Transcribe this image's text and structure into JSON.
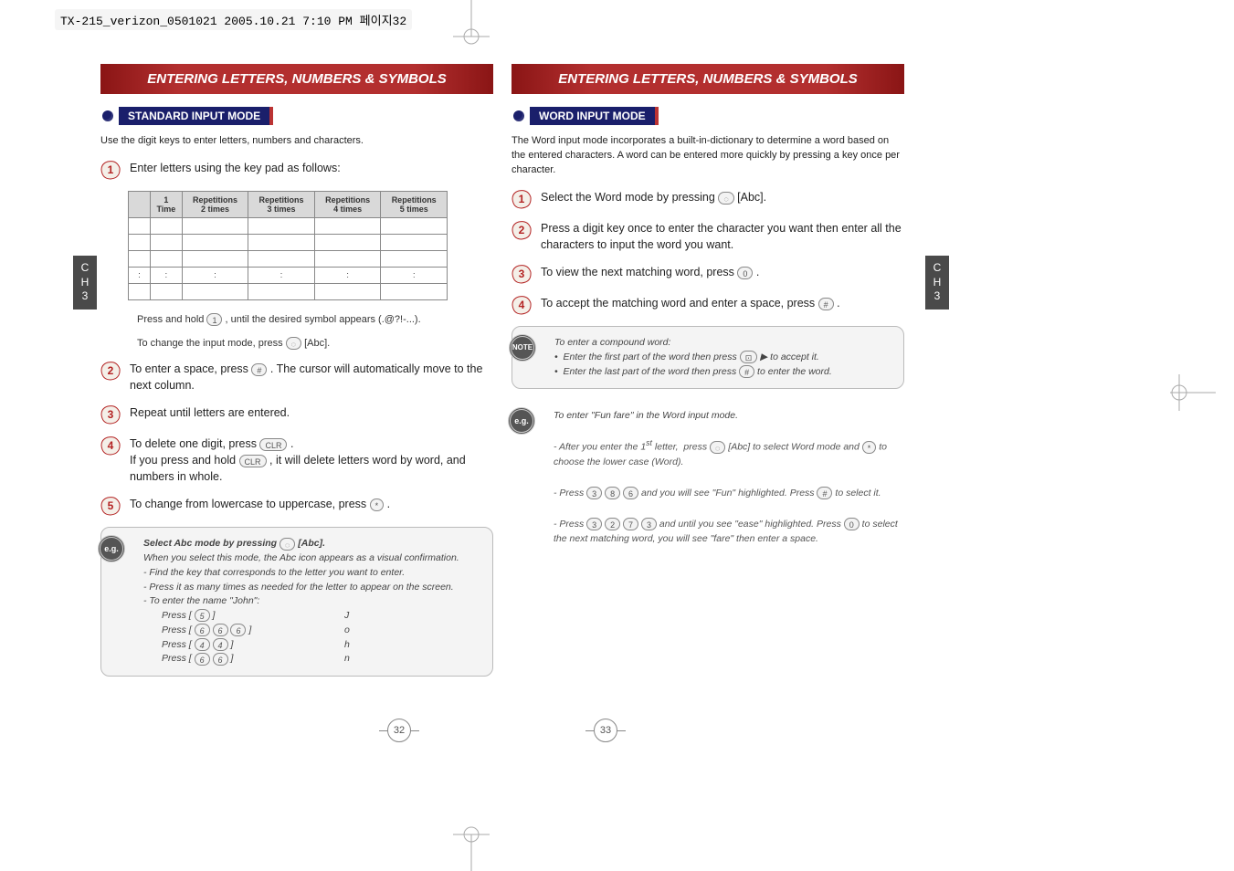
{
  "file_header": "TX-215_verizon_0501021  2005.10.21  7:10 PM  페이지32",
  "chapter_tab": {
    "top": "C\nH",
    "num": "3"
  },
  "left": {
    "title": "ENTERING LETTERS, NUMBERS & SYMBOLS",
    "section": "STANDARD INPUT MODE",
    "intro": "Use the digit keys to enter letters, numbers and characters.",
    "step1": "Enter letters using the key pad as follows:",
    "table_headers": [
      "",
      "1\nTime",
      "Repetitions\n2 times",
      "Repetitions\n3 times",
      "Repetitions\n4 times",
      "Repetitions\n5 times"
    ],
    "table_rows": [
      [
        "",
        "",
        "",
        "",
        "",
        ""
      ],
      [
        "",
        "",
        "",
        "",
        "",
        ""
      ],
      [
        "",
        "",
        "",
        "",
        "",
        ""
      ],
      [
        ":",
        ":",
        ":",
        ":",
        ":",
        ":"
      ],
      [
        "",
        "",
        "",
        "",
        "",
        ""
      ]
    ],
    "step1_note1": "Press and hold        , until the desired symbol appears (.@?!-...).",
    "step1_note2": "To change the input mode, press       [Abc].",
    "step2": "To enter a space, press        . The cursor will automatically move to the next column.",
    "step3": "Repeat until letters are entered.",
    "step4": "To delete one digit, press        .  If you press and hold        , it will delete letters word by word, and numbers in whole.",
    "step5": "To change from lowercase to uppercase, press        .",
    "eg_title": "Select Abc mode by pressing       [Abc].",
    "eg_body1": "When you select this mode, the Abc icon appears as a visual confirmation.",
    "eg_body2": "- Find the key that corresponds to the letter you want to enter.",
    "eg_body3": "- Press it as many times as needed for the letter to appear on the screen.",
    "eg_body4": "- To enter the name \"John\":",
    "eg_rows": [
      {
        "press": "Press [        ]",
        "out": "J"
      },
      {
        "press": "Press [                 ]",
        "out": "o"
      },
      {
        "press": "Press [            ]",
        "out": "h"
      },
      {
        "press": "Press [            ]",
        "out": "n"
      }
    ],
    "page_num": "32"
  },
  "right": {
    "title": "ENTERING LETTERS, NUMBERS & SYMBOLS",
    "section": "WORD INPUT MODE",
    "intro": "The Word input mode incorporates a built-in-dictionary to determine a word based on the entered characters. A word can be entered more quickly by pressing a key once per character.",
    "step1": "Select the Word mode by pressing       [Abc].",
    "step2": "Press a digit key once to enter the character you want then enter all the characters to input the word you want.",
    "step3": "To view the next matching word, press        .",
    "step4": "To accept the matching word and enter a space, press        .",
    "note_title": "To enter a compound word:",
    "note_b1": "Enter the first part of the word then press      ▶ to accept it.",
    "note_b2": "Enter the last part of the word then press        to enter the word.",
    "eg_title": "To enter \"Fun fare\" in the Word input mode.",
    "eg_l1": "- After you enter the 1st letter,  press        [Abc] to select Word mode and        to choose the lower case (Word).",
    "eg_l2": "- Press                       and you will see \"Fun\" highlighted. Press        to select it.",
    "eg_l3": "- Press                               and until you see \"ease\" highlighted. Press        to select the next matching word, you will see \"fare\" then enter a space.",
    "page_num": "33"
  }
}
